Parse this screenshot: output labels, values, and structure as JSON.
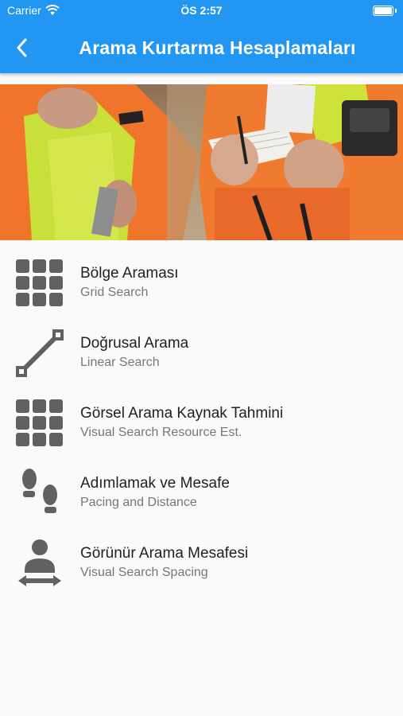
{
  "status_bar": {
    "carrier": "Carrier",
    "time": "ÖS 2:57",
    "wifi_icon": "wifi-icon",
    "battery_icon": "battery-icon"
  },
  "app_bar": {
    "title": "Arama Kurtarma Hesaplamaları",
    "back_icon": "chevron-left-icon",
    "color": "#2196f3"
  },
  "hero": {
    "description_icon": "photo"
  },
  "menu": {
    "items": [
      {
        "title": "Bölge Araması",
        "subtitle": "Grid Search",
        "icon": "grid-icon"
      },
      {
        "title": "Doğrusal Arama",
        "subtitle": "Linear Search",
        "icon": "linear-path-icon"
      },
      {
        "title": "Görsel Arama Kaynak Tahmini",
        "subtitle": "Visual Search Resource Est.",
        "icon": "grid-icon"
      },
      {
        "title": "Adımlamak ve Mesafe",
        "subtitle": "Pacing and Distance",
        "icon": "footprints-icon"
      },
      {
        "title": "Görünür Arama Mesafesi",
        "subtitle": "Visual Search Spacing",
        "icon": "person-spacing-icon"
      }
    ]
  }
}
